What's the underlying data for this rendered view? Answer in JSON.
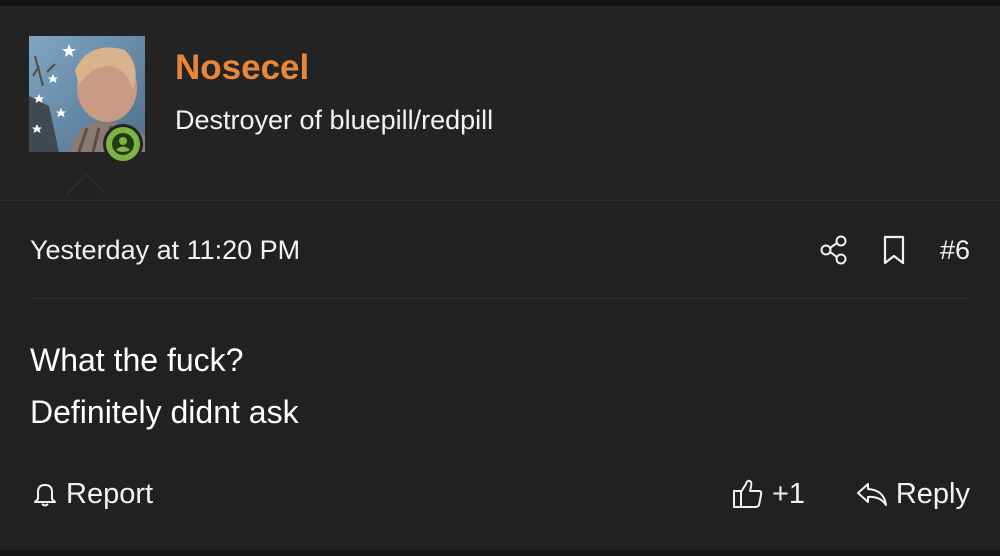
{
  "user": {
    "name": "Nosecel",
    "title": "Destroyer of bluepill/redpill",
    "avatar_icon": "user-avatar",
    "online_icon": "online-user-icon",
    "name_color": "#e8873a",
    "online_color": "#7cb342"
  },
  "post": {
    "timestamp": "Yesterday at 11:20 PM",
    "number": "#6",
    "share_icon": "share-icon",
    "bookmark_icon": "bookmark-icon",
    "body_lines": [
      "What the fuck?",
      "Definitely didnt ask"
    ]
  },
  "actions": {
    "report_label": "Report",
    "report_icon": "bell-icon",
    "like_label": "+1",
    "like_icon": "thumbs-up-icon",
    "reply_label": "Reply",
    "reply_icon": "reply-arrow-icon"
  }
}
